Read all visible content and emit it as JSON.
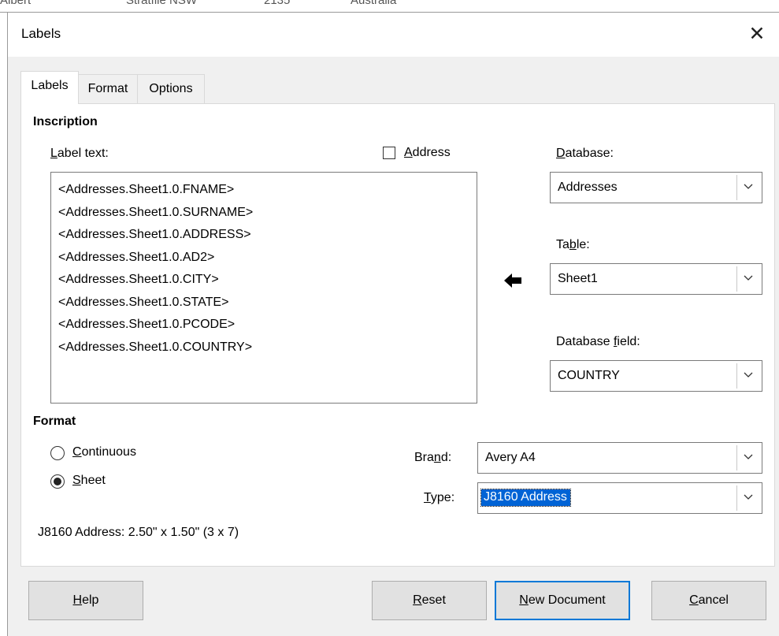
{
  "background": {
    "fragments": [
      "Albert",
      "Stratfile NSW",
      "2135",
      "Australia"
    ]
  },
  "dialog": {
    "title": "Labels",
    "close_icon": "close-icon"
  },
  "tabs": [
    {
      "label": "Labels",
      "active": true
    },
    {
      "label": "Format",
      "active": false
    },
    {
      "label": "Options",
      "active": false
    }
  ],
  "inscription": {
    "heading": "Inscription",
    "label_text_label": "Label text:",
    "address_checkbox": {
      "label": "Address",
      "checked": false
    },
    "label_text_lines": [
      "<Addresses.Sheet1.0.FNAME>",
      "<Addresses.Sheet1.0.SURNAME>",
      "<Addresses.Sheet1.0.ADDRESS>",
      "<Addresses.Sheet1.0.AD2>",
      "<Addresses.Sheet1.0.CITY>",
      "<Addresses.Sheet1.0.STATE>",
      "<Addresses.Sheet1.0.PCODE>",
      "<Addresses.Sheet1.0.COUNTRY>"
    ],
    "insert_arrow_icon": "arrow-left-icon",
    "database": {
      "label": "Database:",
      "value": "Addresses"
    },
    "table": {
      "label": "Table:",
      "value": "Sheet1"
    },
    "database_field": {
      "label": "Database field:",
      "value": "COUNTRY"
    }
  },
  "format": {
    "heading": "Format",
    "continuous": {
      "label": "Continuous",
      "selected": false
    },
    "sheet": {
      "label": "Sheet",
      "selected": true
    },
    "brand": {
      "label": "Brand:",
      "value": "Avery A4"
    },
    "type": {
      "label": "Type:",
      "value": "J8160 Address"
    },
    "summary": "J8160 Address: 2.50\" x 1.50\" (3 x 7)"
  },
  "buttons": {
    "help": "Help",
    "reset": "Reset",
    "new_document": "New Document",
    "cancel": "Cancel"
  },
  "colors": {
    "accent": "#0078d7",
    "selection": "#0063d5"
  }
}
